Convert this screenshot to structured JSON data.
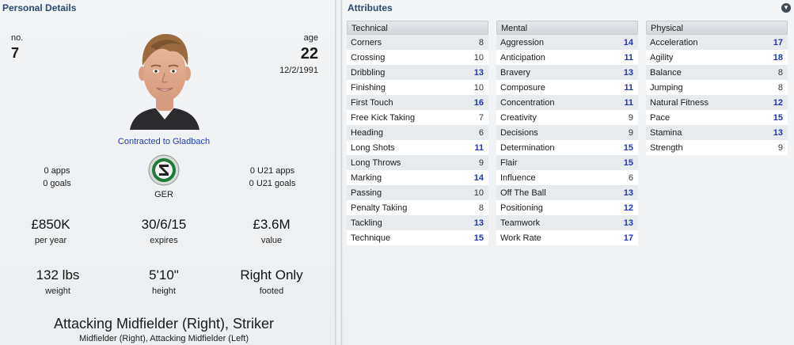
{
  "personal": {
    "header": "Personal Details",
    "no_label": "no.",
    "no_value": "7",
    "age_label": "age",
    "age_value": "22",
    "dob": "12/2/1991",
    "contract": "Contracted to Gladbach",
    "apps": "0 apps",
    "goals": "0 goals",
    "u21_apps": "0 U21 apps",
    "u21_goals": "0 U21 goals",
    "nation": "GER",
    "wage": "£850K",
    "wage_label": "per year",
    "expires": "30/6/15",
    "expires_label": "expires",
    "value": "£3.6M",
    "value_label": "value",
    "weight": "132 lbs",
    "weight_label": "weight",
    "height": "5'10\"",
    "height_label": "height",
    "footed": "Right Only",
    "footed_label": "footed",
    "position_main": "Attacking Midfielder (Right), Striker",
    "position_sub": "Midfielder (Right), Attacking Midfielder (Left)"
  },
  "attributes": {
    "header": "Attributes",
    "technical": {
      "title": "Technical",
      "rows": [
        {
          "label": "Corners",
          "value": "8"
        },
        {
          "label": "Crossing",
          "value": "10"
        },
        {
          "label": "Dribbling",
          "value": "13"
        },
        {
          "label": "Finishing",
          "value": "10"
        },
        {
          "label": "First Touch",
          "value": "16"
        },
        {
          "label": "Free Kick Taking",
          "value": "7"
        },
        {
          "label": "Heading",
          "value": "6"
        },
        {
          "label": "Long Shots",
          "value": "11"
        },
        {
          "label": "Long Throws",
          "value": "9"
        },
        {
          "label": "Marking",
          "value": "14"
        },
        {
          "label": "Passing",
          "value": "10"
        },
        {
          "label": "Penalty Taking",
          "value": "8"
        },
        {
          "label": "Tackling",
          "value": "13"
        },
        {
          "label": "Technique",
          "value": "15"
        }
      ]
    },
    "mental": {
      "title": "Mental",
      "rows": [
        {
          "label": "Aggression",
          "value": "14"
        },
        {
          "label": "Anticipation",
          "value": "11"
        },
        {
          "label": "Bravery",
          "value": "13"
        },
        {
          "label": "Composure",
          "value": "11"
        },
        {
          "label": "Concentration",
          "value": "11"
        },
        {
          "label": "Creativity",
          "value": "9"
        },
        {
          "label": "Decisions",
          "value": "9"
        },
        {
          "label": "Determination",
          "value": "15"
        },
        {
          "label": "Flair",
          "value": "15"
        },
        {
          "label": "Influence",
          "value": "6"
        },
        {
          "label": "Off The Ball",
          "value": "13"
        },
        {
          "label": "Positioning",
          "value": "12"
        },
        {
          "label": "Teamwork",
          "value": "13"
        },
        {
          "label": "Work Rate",
          "value": "17"
        }
      ]
    },
    "physical": {
      "title": "Physical",
      "rows": [
        {
          "label": "Acceleration",
          "value": "17"
        },
        {
          "label": "Agility",
          "value": "18"
        },
        {
          "label": "Balance",
          "value": "8"
        },
        {
          "label": "Jumping",
          "value": "8"
        },
        {
          "label": "Natural Fitness",
          "value": "12"
        },
        {
          "label": "Pace",
          "value": "15"
        },
        {
          "label": "Stamina",
          "value": "13"
        },
        {
          "label": "Strength",
          "value": "9"
        }
      ]
    }
  },
  "colors": {
    "header_text": "#2c4a6e",
    "highlight_value": "#1f35b8",
    "contract_link": "#1f3fb5"
  }
}
